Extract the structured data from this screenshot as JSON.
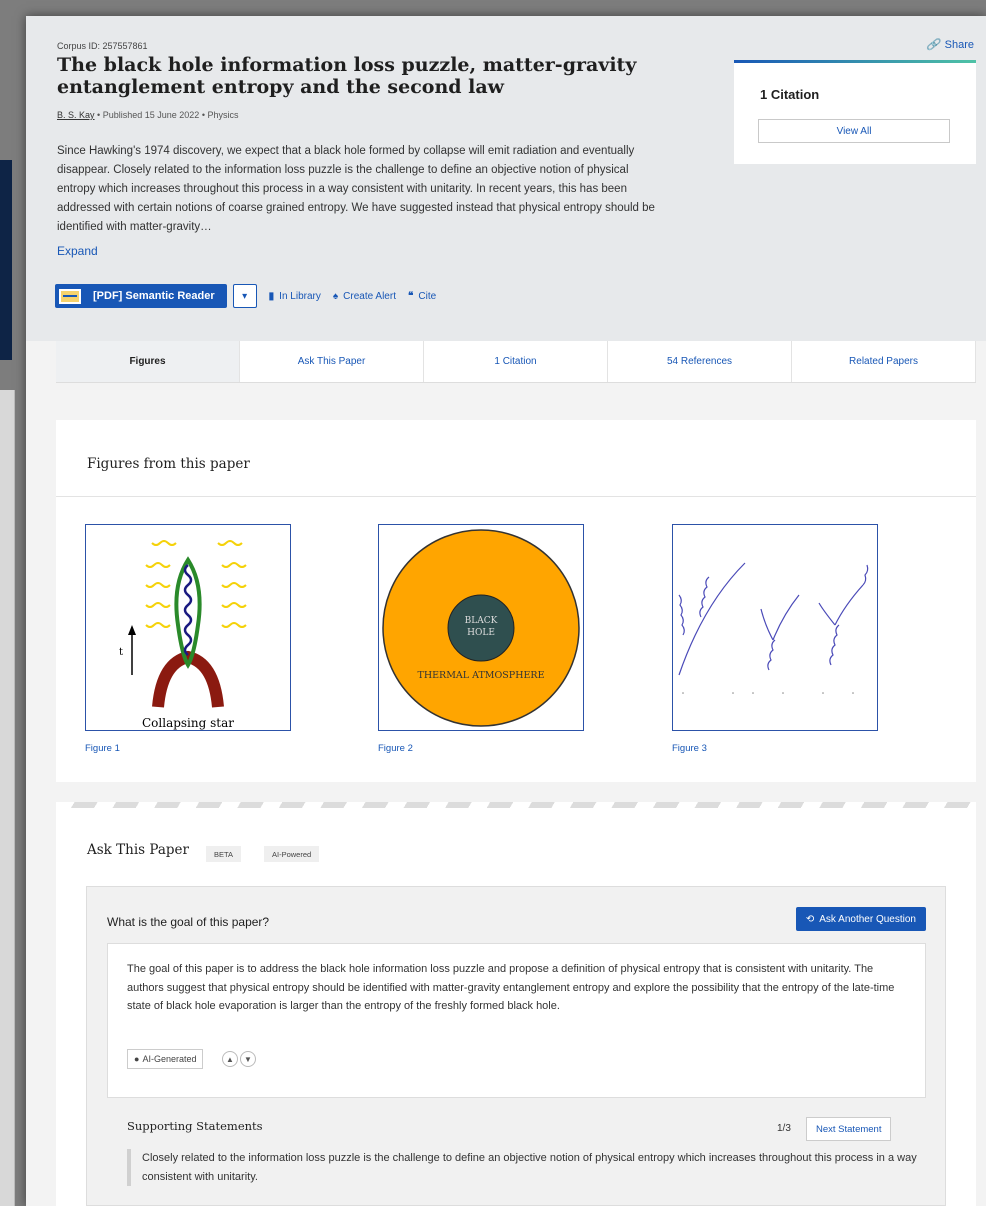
{
  "paper": {
    "corpus_id": "Corpus ID: 257557861",
    "share_label": "Share",
    "title": "The black hole information loss puzzle, matter-gravity entanglement entropy and the second law",
    "author": "B. S. Kay",
    "published": "Published 15 June 2022",
    "field": "Physics",
    "abstract": "Since Hawking's 1974 discovery, we expect that a black hole formed by collapse will emit radiation and eventually disappear. Closely related to the information loss puzzle is the challenge to define an objective notion of physical entropy which increases throughout this process in a way consistent with unitarity. In recent years, this has been addressed with certain notions of coarse grained entropy. We have suggested instead that physical entropy should be identified with matter-gravity…",
    "expand_label": "Expand"
  },
  "actions": {
    "reader_label": "[PDF] Semantic Reader",
    "dropdown_icon": "chevron-down-icon",
    "library_label": "In Library",
    "alert_label": "Create Alert",
    "cite_label": "Cite"
  },
  "citations_card": {
    "count_label": "1 Citation",
    "view_all_label": "View All"
  },
  "tabs": [
    {
      "label": "Figures",
      "active": true
    },
    {
      "label": "Ask This Paper",
      "active": false
    },
    {
      "label": "1 Citation",
      "active": false
    },
    {
      "label": "54 References",
      "active": false
    },
    {
      "label": "Related Papers",
      "active": false
    }
  ],
  "figures": {
    "section_title": "Figures from this paper",
    "items": [
      {
        "caption": "Figure 1",
        "image_text": [
          "Collapsing star",
          "t"
        ]
      },
      {
        "caption": "Figure 2",
        "image_text": [
          "BLACK",
          "HOLE",
          "THERMAL ATMOSPHERE"
        ]
      },
      {
        "caption": "Figure 3",
        "image_text": []
      }
    ]
  },
  "ask": {
    "title": "Ask This Paper",
    "beta_chip": "BETA",
    "ai_chip": "AI-Powered",
    "question": "What is the goal of this paper?",
    "ask_another_label": "Ask Another Question",
    "answer": "The goal of this paper is to address the black hole information loss puzzle and propose a definition of physical entropy that is consistent with unitarity. The authors suggest that physical entropy should be identified with matter-gravity entanglement entropy and explore the possibility that the entropy of the late-time state of black hole evaporation is larger than the entropy of the freshly formed black hole.",
    "ai_generated_label": "AI-Generated",
    "supporting_title": "Supporting Statements",
    "supporting_count": "1/3",
    "next_label": "Next Statement",
    "statement": "Closely related to the information loss puzzle is the challenge to define an objective notion of physical entropy which increases throughout this process in a way consistent with unitarity."
  },
  "colors": {
    "accent": "#1857b6",
    "header_bg": "#e7e9eb",
    "figure_orange": "#ffa500",
    "black_hole": "#2f4f4f"
  }
}
